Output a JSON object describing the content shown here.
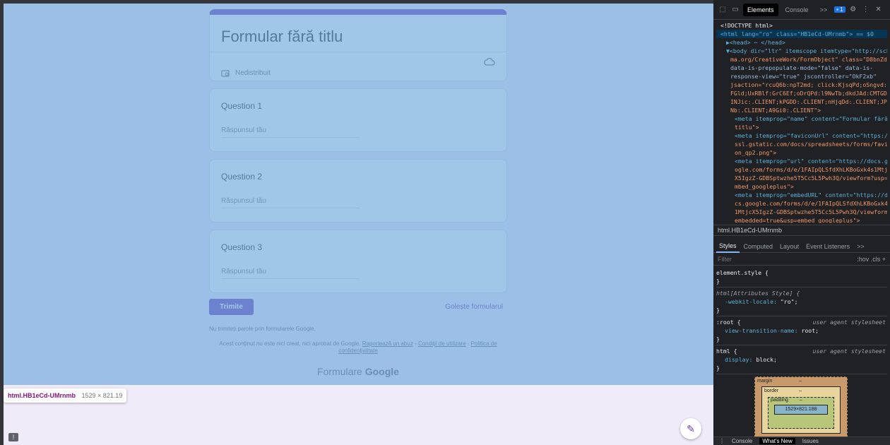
{
  "form": {
    "title": "Formular fără titlu",
    "status": "Nedistribuit",
    "questions": [
      {
        "title": "Question 1",
        "placeholder": "Răspunsul tău"
      },
      {
        "title": "Question 2",
        "placeholder": "Răspunsul tău"
      },
      {
        "title": "Question 3",
        "placeholder": "Răspunsul tău"
      }
    ],
    "submit_label": "Trimite",
    "clear_label": "Golește formularul",
    "note": "Nu trimiteți parole prin formularele Google.",
    "disclaimer": "Acest conținut nu este nici creat, nici aprobat de Google.",
    "report_link": "Raportează un abuz",
    "terms_link": "Condiții de utilizare",
    "privacy_link": "Politica de confidențialitate",
    "brand_prefix": "Formulare",
    "brand_name": "Google",
    "accent_color": "#673ab7"
  },
  "inspect_tooltip": {
    "selector": "html.HB1eCd-UMrnmb",
    "size": "1529 × 821.19"
  },
  "devtools": {
    "tabs": {
      "elements": "Elements",
      "console": "Console",
      "more": ">>",
      "issues_count": "1"
    },
    "dom_lines": [
      "<!DOCTYPE html>",
      "<html lang=\"ro\" class=\"HB1eCd-UMrnmb\"> == $0",
      "▶<head> ⋯ </head>",
      "▼<body dir=\"ltr\" itemscope itemtype=\"http://sche",
      "ma.org/CreativeWork/FormObject\" class=\"D8bnZd\"",
      "data-is-prepopulate-mode=\"false\" data-is-",
      "response-view=\"true\" jscontroller=\"OkF2xb\"",
      "jsaction=\"rcuQ6b:npT2md; click:KjsqPd;oSngvd:KW",
      "FGld;UxRBlf:GrC6Ef;oDrQPd:l9NwTb;dkdJAd:CMTGD;w",
      "INJic:.CLIENT;kPGDD:.CLIENT;nHjqDd:.CLIENT;JPpw",
      "Nb:.CLIENT;A9Gi0:.CLIENT\">",
      "<meta itemprop=\"name\" content=\"Formular fără",
      "titlu\">",
      "<meta itemprop=\"faviconUrl\" content=\"https://",
      "ssl.gstatic.com/docs/spreadsheets/forms/favic",
      "on_qp2.png\">",
      "<meta itemprop=\"url\" content=\"https://docs.go",
      "ogle.com/forms/d/e/1FAIpQLSfdXhLKBoGxk4s1Mtjc",
      "X5IgzZ-GDBSptwzhe5T5Cc5L5Pwh3Q/viewform?usp=e",
      "mbed_googleplus\">",
      "<meta itemprop=\"embedURL\" content=\"https://do",
      "cs.google.com/forms/d/e/1FAIpQLSfdXhLKBoGxk4s",
      "1MtjcX5IgzZ-GDBSptwzhe5T5Cc5L5Pwh3Q/viewform?",
      "embedded=true&usp=embed_googleplus\">"
    ],
    "breadcrumb": "html.HB1eCd-UMrnmb",
    "sub_tabs": [
      "Styles",
      "Computed",
      "Layout",
      "Event Listeners",
      ">>"
    ],
    "filter_placeholder": "Filter",
    "filter_tools": ":hov  .cls  +",
    "rules": [
      {
        "selector": "element.style {",
        "source": "",
        "props": [],
        "close": "}"
      },
      {
        "selector": "html[Attributes Style] {",
        "source": "",
        "props": [
          {
            "name": "-webkit-locale",
            "value": "\"ro\";"
          }
        ],
        "close": "}"
      },
      {
        "selector": ":root {",
        "source": "user agent stylesheet",
        "props": [
          {
            "name": "view-transition-name",
            "value": "root;"
          }
        ],
        "close": "}"
      },
      {
        "selector": "html {",
        "source": "user agent stylesheet",
        "props": [
          {
            "name": "display",
            "value": "block;"
          }
        ],
        "close": "}"
      }
    ],
    "box_model": {
      "margin": "margin",
      "border": "border",
      "padding": "padding",
      "content": "1529×821.188",
      "dash": "–"
    },
    "drawer_tabs": [
      "Console",
      "What's New",
      "Issues"
    ]
  }
}
